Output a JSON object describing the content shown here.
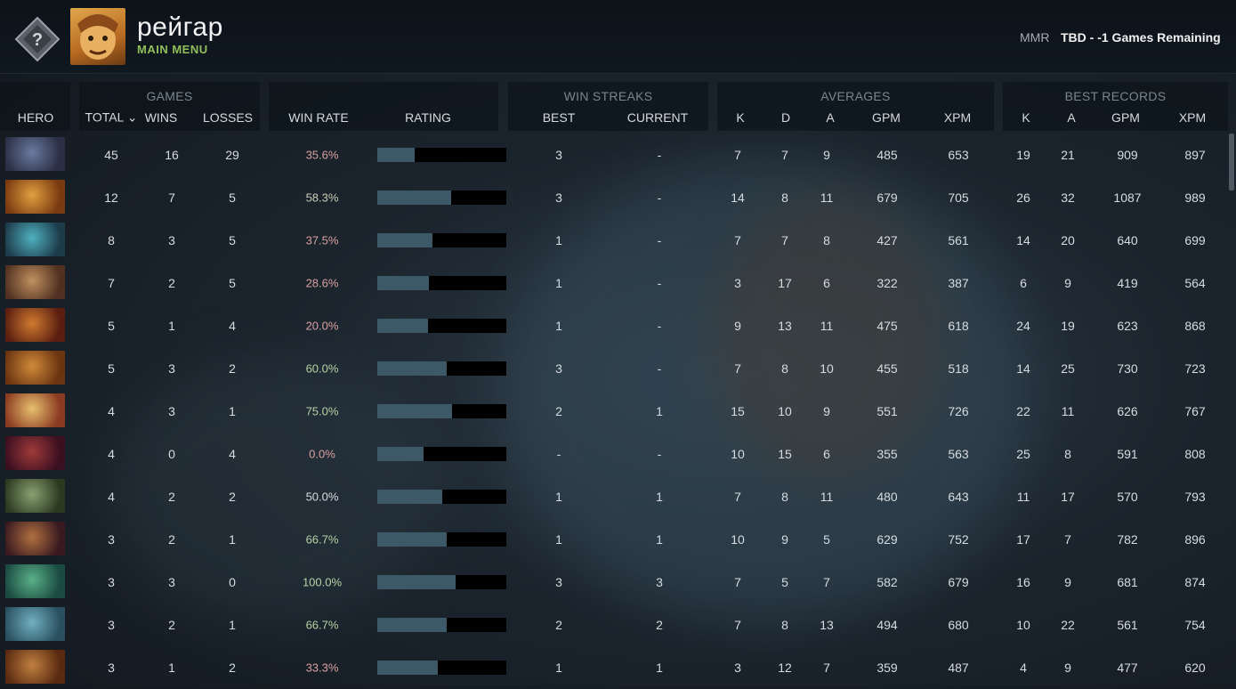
{
  "header": {
    "player_name": "рейгар",
    "main_menu": "MAIN MENU",
    "mmr_label": "MMR",
    "mmr_value": "TBD - -1 Games Remaining"
  },
  "table": {
    "groups": {
      "games": "GAMES",
      "win_streaks": "WIN STREAKS",
      "averages": "AVERAGES",
      "best_records": "BEST RECORDS"
    },
    "columns": {
      "hero": "HERO",
      "total": "TOTAL ⌄",
      "wins": "WINS",
      "losses": "LOSSES",
      "win_rate": "WIN RATE",
      "rating": "RATING",
      "best": "BEST",
      "current": "CURRENT",
      "avg_k": "K",
      "avg_d": "D",
      "avg_a": "A",
      "avg_gpm": "GPM",
      "avg_xpm": "XPM",
      "best_k": "K",
      "best_a": "A",
      "best_gpm": "GPM",
      "best_xpm": "XPM"
    },
    "rows": [
      {
        "total": "45",
        "wins": "16",
        "losses": "29",
        "win_rate": "35.6%",
        "rating": 0.29,
        "best": "3",
        "current": "-",
        "k": "7",
        "d": "7",
        "a": "9",
        "gpm": "485",
        "xpm": "653",
        "bk": "19",
        "ba": "21",
        "bgpm": "909",
        "bxpm": "897",
        "win_color": "#d9a0a0"
      },
      {
        "total": "12",
        "wins": "7",
        "losses": "5",
        "win_rate": "58.3%",
        "rating": 0.57,
        "best": "3",
        "current": "-",
        "k": "14",
        "d": "8",
        "a": "11",
        "gpm": "679",
        "xpm": "705",
        "bk": "26",
        "ba": "32",
        "bgpm": "1087",
        "bxpm": "989",
        "win_color": "#c9cfb6"
      },
      {
        "total": "8",
        "wins": "3",
        "losses": "5",
        "win_rate": "37.5%",
        "rating": 0.43,
        "best": "1",
        "current": "-",
        "k": "7",
        "d": "7",
        "a": "8",
        "gpm": "427",
        "xpm": "561",
        "bk": "14",
        "ba": "20",
        "bgpm": "640",
        "bxpm": "699",
        "win_color": "#d9a0a0"
      },
      {
        "total": "7",
        "wins": "2",
        "losses": "5",
        "win_rate": "28.6%",
        "rating": 0.4,
        "best": "1",
        "current": "-",
        "k": "3",
        "d": "17",
        "a": "6",
        "gpm": "322",
        "xpm": "387",
        "bk": "6",
        "ba": "9",
        "bgpm": "419",
        "bxpm": "564",
        "win_color": "#d9a0a0"
      },
      {
        "total": "5",
        "wins": "1",
        "losses": "4",
        "win_rate": "20.0%",
        "rating": 0.39,
        "best": "1",
        "current": "-",
        "k": "9",
        "d": "13",
        "a": "11",
        "gpm": "475",
        "xpm": "618",
        "bk": "24",
        "ba": "19",
        "bgpm": "623",
        "bxpm": "868",
        "win_color": "#d9a0a0"
      },
      {
        "total": "5",
        "wins": "3",
        "losses": "2",
        "win_rate": "60.0%",
        "rating": 0.54,
        "best": "3",
        "current": "-",
        "k": "7",
        "d": "8",
        "a": "10",
        "gpm": "455",
        "xpm": "518",
        "bk": "14",
        "ba": "25",
        "bgpm": "730",
        "bxpm": "723",
        "win_color": "#b6d2a6"
      },
      {
        "total": "4",
        "wins": "3",
        "losses": "1",
        "win_rate": "75.0%",
        "rating": 0.58,
        "best": "2",
        "current": "1",
        "k": "15",
        "d": "10",
        "a": "9",
        "gpm": "551",
        "xpm": "726",
        "bk": "22",
        "ba": "11",
        "bgpm": "626",
        "bxpm": "767",
        "win_color": "#b6d2a6"
      },
      {
        "total": "4",
        "wins": "0",
        "losses": "4",
        "win_rate": "0.0%",
        "rating": 0.36,
        "best": "-",
        "current": "-",
        "k": "10",
        "d": "15",
        "a": "6",
        "gpm": "355",
        "xpm": "563",
        "bk": "25",
        "ba": "8",
        "bgpm": "591",
        "bxpm": "808",
        "win_color": "#d9a0a0"
      },
      {
        "total": "4",
        "wins": "2",
        "losses": "2",
        "win_rate": "50.0%",
        "rating": 0.5,
        "best": "1",
        "current": "1",
        "k": "7",
        "d": "8",
        "a": "11",
        "gpm": "480",
        "xpm": "643",
        "bk": "11",
        "ba": "17",
        "bgpm": "570",
        "bxpm": "793",
        "win_color": "#d6dce0"
      },
      {
        "total": "3",
        "wins": "2",
        "losses": "1",
        "win_rate": "66.7%",
        "rating": 0.54,
        "best": "1",
        "current": "1",
        "k": "10",
        "d": "9",
        "a": "5",
        "gpm": "629",
        "xpm": "752",
        "bk": "17",
        "ba": "7",
        "bgpm": "782",
        "bxpm": "896",
        "win_color": "#b6d2a6"
      },
      {
        "total": "3",
        "wins": "3",
        "losses": "0",
        "win_rate": "100.0%",
        "rating": 0.61,
        "best": "3",
        "current": "3",
        "k": "7",
        "d": "5",
        "a": "7",
        "gpm": "582",
        "xpm": "679",
        "bk": "16",
        "ba": "9",
        "bgpm": "681",
        "bxpm": "874",
        "win_color": "#b6d2a6"
      },
      {
        "total": "3",
        "wins": "2",
        "losses": "1",
        "win_rate": "66.7%",
        "rating": 0.54,
        "best": "2",
        "current": "2",
        "k": "7",
        "d": "8",
        "a": "13",
        "gpm": "494",
        "xpm": "680",
        "bk": "10",
        "ba": "22",
        "bgpm": "561",
        "bxpm": "754",
        "win_color": "#b6d2a6"
      },
      {
        "total": "3",
        "wins": "1",
        "losses": "2",
        "win_rate": "33.3%",
        "rating": 0.47,
        "best": "1",
        "current": "1",
        "k": "3",
        "d": "12",
        "a": "7",
        "gpm": "359",
        "xpm": "487",
        "bk": "4",
        "ba": "9",
        "bgpm": "477",
        "bxpm": "620",
        "win_color": "#d9a0a0"
      }
    ],
    "hero_colors": [
      [
        "#6a7aa0",
        "#2b2f45"
      ],
      [
        "#e0a040",
        "#7a3a10"
      ],
      [
        "#4fb0c0",
        "#1d3c4a"
      ],
      [
        "#c09060",
        "#503020"
      ],
      [
        "#d07a30",
        "#5a1e10"
      ],
      [
        "#d08a3a",
        "#6a3410"
      ],
      [
        "#e8c070",
        "#8a3a20"
      ],
      [
        "#a03a3a",
        "#3a0f20"
      ],
      [
        "#8aa070",
        "#2a3a20"
      ],
      [
        "#b07040",
        "#3a1a20"
      ],
      [
        "#5ab088",
        "#1a4a40"
      ],
      [
        "#70b0c0",
        "#2a5060"
      ],
      [
        "#c08040",
        "#5a2a10"
      ]
    ]
  }
}
